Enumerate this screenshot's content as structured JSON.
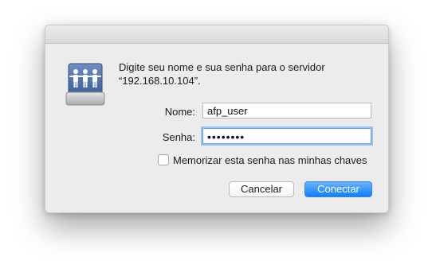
{
  "dialog": {
    "message_line1": "Digite seu nome e sua senha para o servidor",
    "message_line2": "“192.168.10.104”.",
    "icon": "shared-server-icon",
    "name_label": "Nome:",
    "name_value": "afp_user",
    "password_label": "Senha:",
    "password_value": "••••••••",
    "remember_checked": false,
    "remember_label": "Memorizar esta senha nas minhas chaves",
    "cancel_label": "Cancelar",
    "connect_label": "Conectar",
    "accent_color": "#0d81f8"
  }
}
